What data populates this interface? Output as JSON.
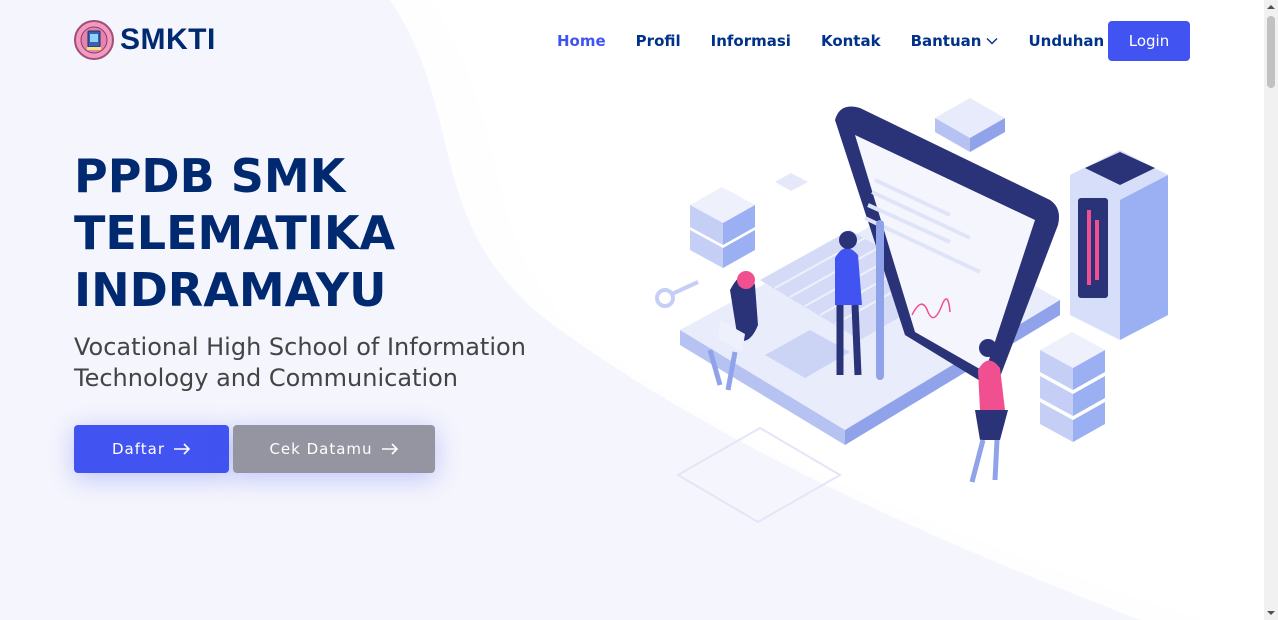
{
  "brand": {
    "name": "SMKTI",
    "icon": "school-crest-icon"
  },
  "nav": {
    "items": [
      {
        "label": "Home",
        "active": true
      },
      {
        "label": "Profil"
      },
      {
        "label": "Informasi"
      },
      {
        "label": "Kontak"
      },
      {
        "label": "Bantuan",
        "dropdown": true
      },
      {
        "label": "Unduhan",
        "dropdown": true
      }
    ],
    "login_label": "Login"
  },
  "hero": {
    "title_line1": "PPDB SMK",
    "title_line2": "TELEMATIKA",
    "title_line3": "INDRAMAYU",
    "subtitle": "Vocational High School of Information Technology and Communication",
    "btn_primary": "Daftar",
    "btn_secondary": "Cek Datamu"
  },
  "colors": {
    "accent": "#4154f1",
    "heading": "#012970",
    "secondary_button": "#9595a2",
    "background": "#f4f5fd"
  }
}
